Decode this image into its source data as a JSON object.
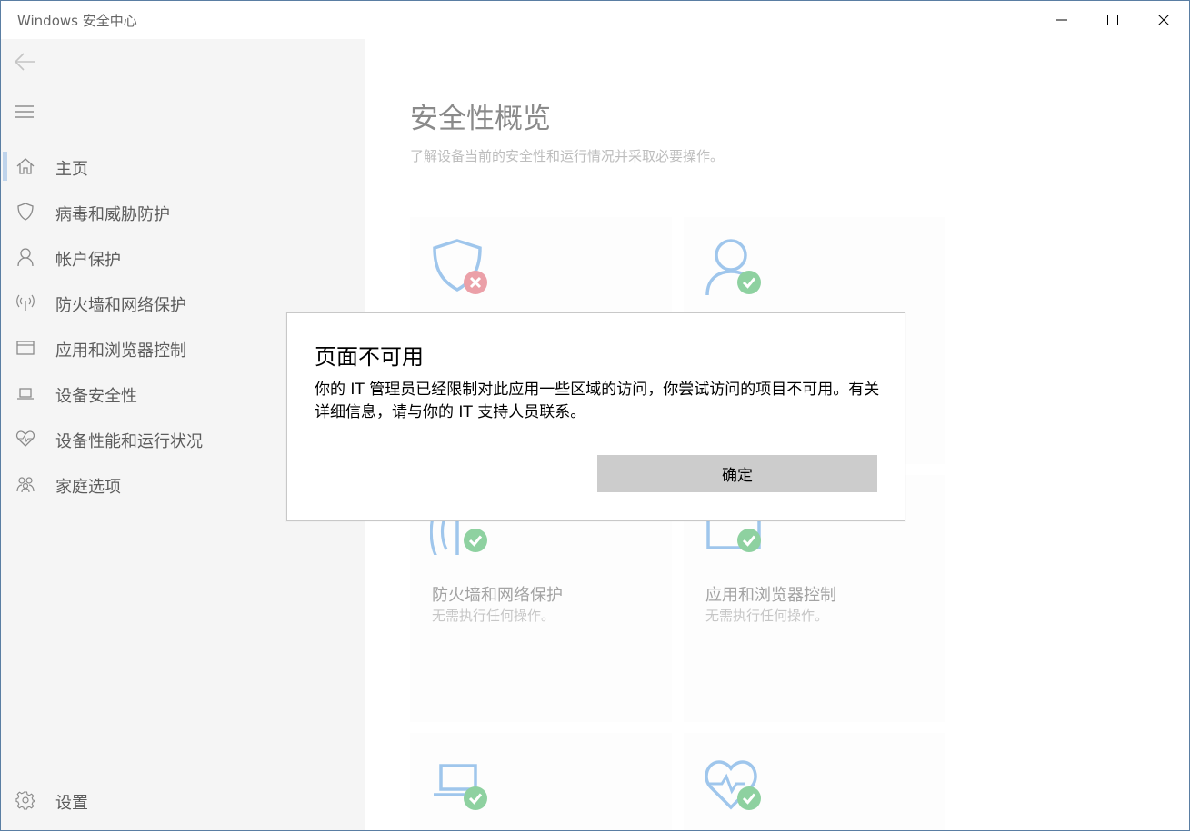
{
  "window": {
    "title": "Windows 安全中心"
  },
  "sidebar": {
    "items": [
      {
        "label": "主页"
      },
      {
        "label": "病毒和威胁防护"
      },
      {
        "label": "帐户保护"
      },
      {
        "label": "防火墙和网络保护"
      },
      {
        "label": "应用和浏览器控制"
      },
      {
        "label": "设备安全性"
      },
      {
        "label": "设备性能和运行状况"
      },
      {
        "label": "家庭选项"
      }
    ],
    "settings_label": "设置"
  },
  "main": {
    "title": "安全性概览",
    "subtitle": "了解设备当前的安全性和运行情况并采取必要操作。",
    "tiles": [
      {
        "name": "防火墙和网络保护",
        "status": "无需执行任何操作。"
      },
      {
        "name": "应用和浏览器控制",
        "status": "无需执行任何操作。"
      }
    ]
  },
  "dialog": {
    "title": "页面不可用",
    "message": "你的 IT 管理员已经限制对此应用一些区域的访问，你尝试访问的项目不可用。有关详细信息，请与你的 IT 支持人员联系。",
    "ok_label": "确定"
  },
  "colors": {
    "icon_blue": "#9fc6ec",
    "status_ok": "#8ed1a0",
    "status_error": "#eba0a8",
    "accent_bar": "#bfd4ec"
  }
}
